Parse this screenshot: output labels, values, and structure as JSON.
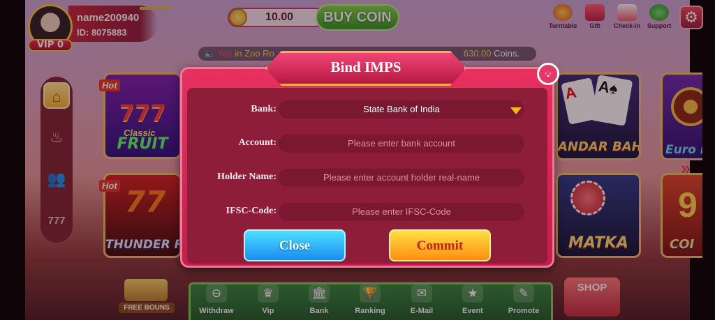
{
  "header": {
    "username": "name200940",
    "user_id": "ID: 8075883",
    "vip_level": "VIP 0",
    "coin_balance": "10.00",
    "buy_coin_label": "BUY COIN"
  },
  "top_icons": [
    {
      "label": "Turntable",
      "icon": "turntable-icon"
    },
    {
      "label": "Gift",
      "icon": "gift-icon"
    },
    {
      "label": "Check-in",
      "icon": "check-in-icon"
    },
    {
      "label": "Support",
      "icon": "support-icon"
    }
  ],
  "marquee": {
    "prefix": "Yes",
    "middle": "in Zoo Ro",
    "amount": "630.00",
    "suffix": "Coins."
  },
  "left_nav": [
    {
      "icon": "home-icon",
      "active": true
    },
    {
      "icon": "fire-icon",
      "active": false
    },
    {
      "icon": "people-icon",
      "active": false
    },
    {
      "icon": "slot-777-icon",
      "active": false
    }
  ],
  "games": {
    "classic_fruit": {
      "tag": "Hot",
      "name": "FRUIT",
      "subname": "Classic"
    },
    "thunder_fire": {
      "tag": "Hot",
      "name": "THUNDER FIR"
    },
    "andar_bahar": {
      "name": "ANDAR BAHAR"
    },
    "matka": {
      "name": "MATKA"
    },
    "euro_roulette": {
      "name": "Euro roul"
    },
    "coin_game": {
      "name": "COI"
    }
  },
  "bottom_nav": [
    {
      "label": "Withdraw",
      "icon": "withdraw-icon"
    },
    {
      "label": "Vip",
      "icon": "vip-icon"
    },
    {
      "label": "Bank",
      "icon": "bank-icon"
    },
    {
      "label": "Ranking",
      "icon": "ranking-icon"
    },
    {
      "label": "E-Mail",
      "icon": "email-icon"
    },
    {
      "label": "Event",
      "icon": "event-icon"
    },
    {
      "label": "Promote",
      "icon": "promote-icon"
    }
  ],
  "free_bonus_label": "FREE BOUNS",
  "shop_label": "SHOP",
  "modal": {
    "title": "Bind IMPS",
    "bank_label": "Bank:",
    "bank_value": "State Bank of India",
    "account_label": "Account:",
    "account_placeholder": "Please enter bank account",
    "holder_label": "Holder Name:",
    "holder_placeholder": "Please enter account holder real-name",
    "ifsc_label": "IFSC-Code:",
    "ifsc_placeholder": "Please enter IFSC-Code",
    "close_label": "Close",
    "commit_label": "Commit"
  },
  "colors": {
    "modal_bg": "#c51d4b",
    "commit_button": "#ff8d12",
    "close_button": "#1c8cf0",
    "buy_coin": "#2f9a21"
  }
}
